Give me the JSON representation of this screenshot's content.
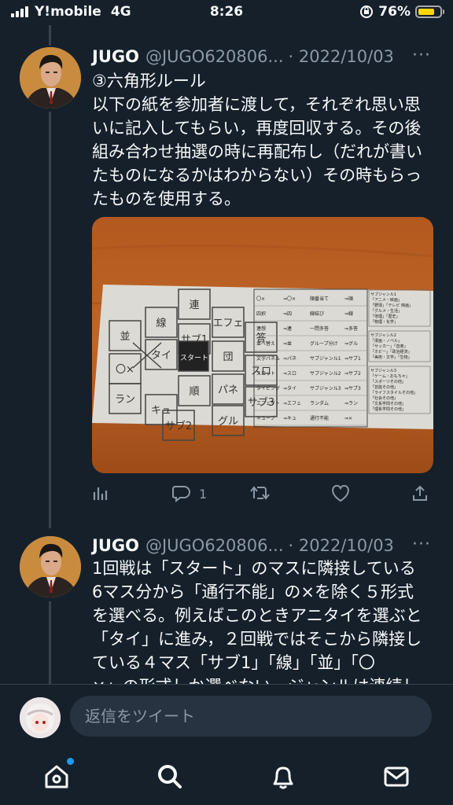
{
  "status_bar": {
    "carrier": "Y!mobile",
    "network": "4G",
    "time": "8:26",
    "battery_percent": "76%",
    "battery_level": 0.76,
    "battery_color": "#ffd60a"
  },
  "tweets": [
    {
      "name": "JUGO",
      "handle": "@JUGO620806...",
      "date": "· 2022/10/03",
      "more": "···",
      "lines": [
        "③六角形ルール",
        "以下の紙を参加者に渡して，それぞれ思い思",
        "いに記入してもらい，再度回収する。その後",
        "組み合わせ抽選の時に再配布し（だれが書い",
        "たものになるかはわからない）その時もらっ",
        "たものを使用する。"
      ],
      "reply_count": "1"
    },
    {
      "name": "JUGO",
      "handle": "@JUGO620806...",
      "date": "· 2022/10/03",
      "more": "···",
      "lines": [
        "1回戦は「スタート」のマスに隣接している",
        "6マス分から「通行不能」の×を除く５形式",
        "を選べる。例えばこのときアニタイを選ぶと",
        "「タイ」に進み，２回戦ではそこから隣接し",
        "ている４マス「サブ1」「線」「並」「〇",
        "×」の形式しか選べない。ジャンルは連続し"
      ]
    }
  ],
  "photo": {
    "hex_cells": [
      "連",
      "線",
      "サブ1",
      "エフェ",
      "並",
      "タイ",
      "スタート",
      "団",
      "答",
      "〇×",
      "スロ",
      "パネ",
      "ラン",
      "キュ",
      "順",
      "サブ3",
      "グル",
      "サブ2"
    ],
    "table_rows": [
      [
        "〇×",
        "⇒〇×",
        "順番当て",
        "⇒順"
      ],
      [
        "四択",
        "⇒四",
        "線結び",
        "⇒線"
      ],
      [
        "連想",
        "⇒連",
        "一問多答",
        "⇒多答"
      ],
      [
        "並べ替え",
        "⇒並",
        "グループ分け",
        "⇒グル"
      ],
      [
        "文字パネル",
        "⇒パネ",
        "サブジャンル1",
        "⇒サブ1"
      ],
      [
        "スロット",
        "⇒スロ",
        "サブジャンル2",
        "⇒サブ2"
      ],
      [
        "タイピング",
        "⇒タイ",
        "サブジャンル3",
        "⇒サブ3"
      ],
      [
        "エフェクト",
        "⇒エフェ",
        "ランダム",
        "⇒ラン"
      ],
      [
        "キューブ",
        "⇒キュ",
        "通行不能",
        "⇒×"
      ]
    ],
    "side_notes": [
      [
        "サブジャンル1",
        "「アニメ・映画」",
        "「野球」「テレビ 映画」",
        "「グルメ・生活」",
        "「地理」「歴史」",
        "「物理・化学」"
      ],
      [
        "サブジャンル2",
        "「漫画・ノベル」",
        "「サッカー」「音楽」",
        "「ホビー」「政治経済」",
        "「美術・文学」「生物」"
      ],
      [
        "サブジャンル3",
        "「ゲーム・おもちゃ」",
        "「スポーツその他」",
        "「芸能その他」",
        "「ライフスタイルその他」",
        "「社会その他」",
        "「文系学問その他」",
        "「理系学問その他」"
      ]
    ]
  },
  "reply_placeholder": "返信をツイート",
  "nav_icons": [
    "home-icon",
    "search-icon",
    "notifications-icon",
    "messages-icon"
  ],
  "colors": {
    "background": "#15202b",
    "accent": "#1d9bf0",
    "secondary_text": "#8b98a5"
  }
}
